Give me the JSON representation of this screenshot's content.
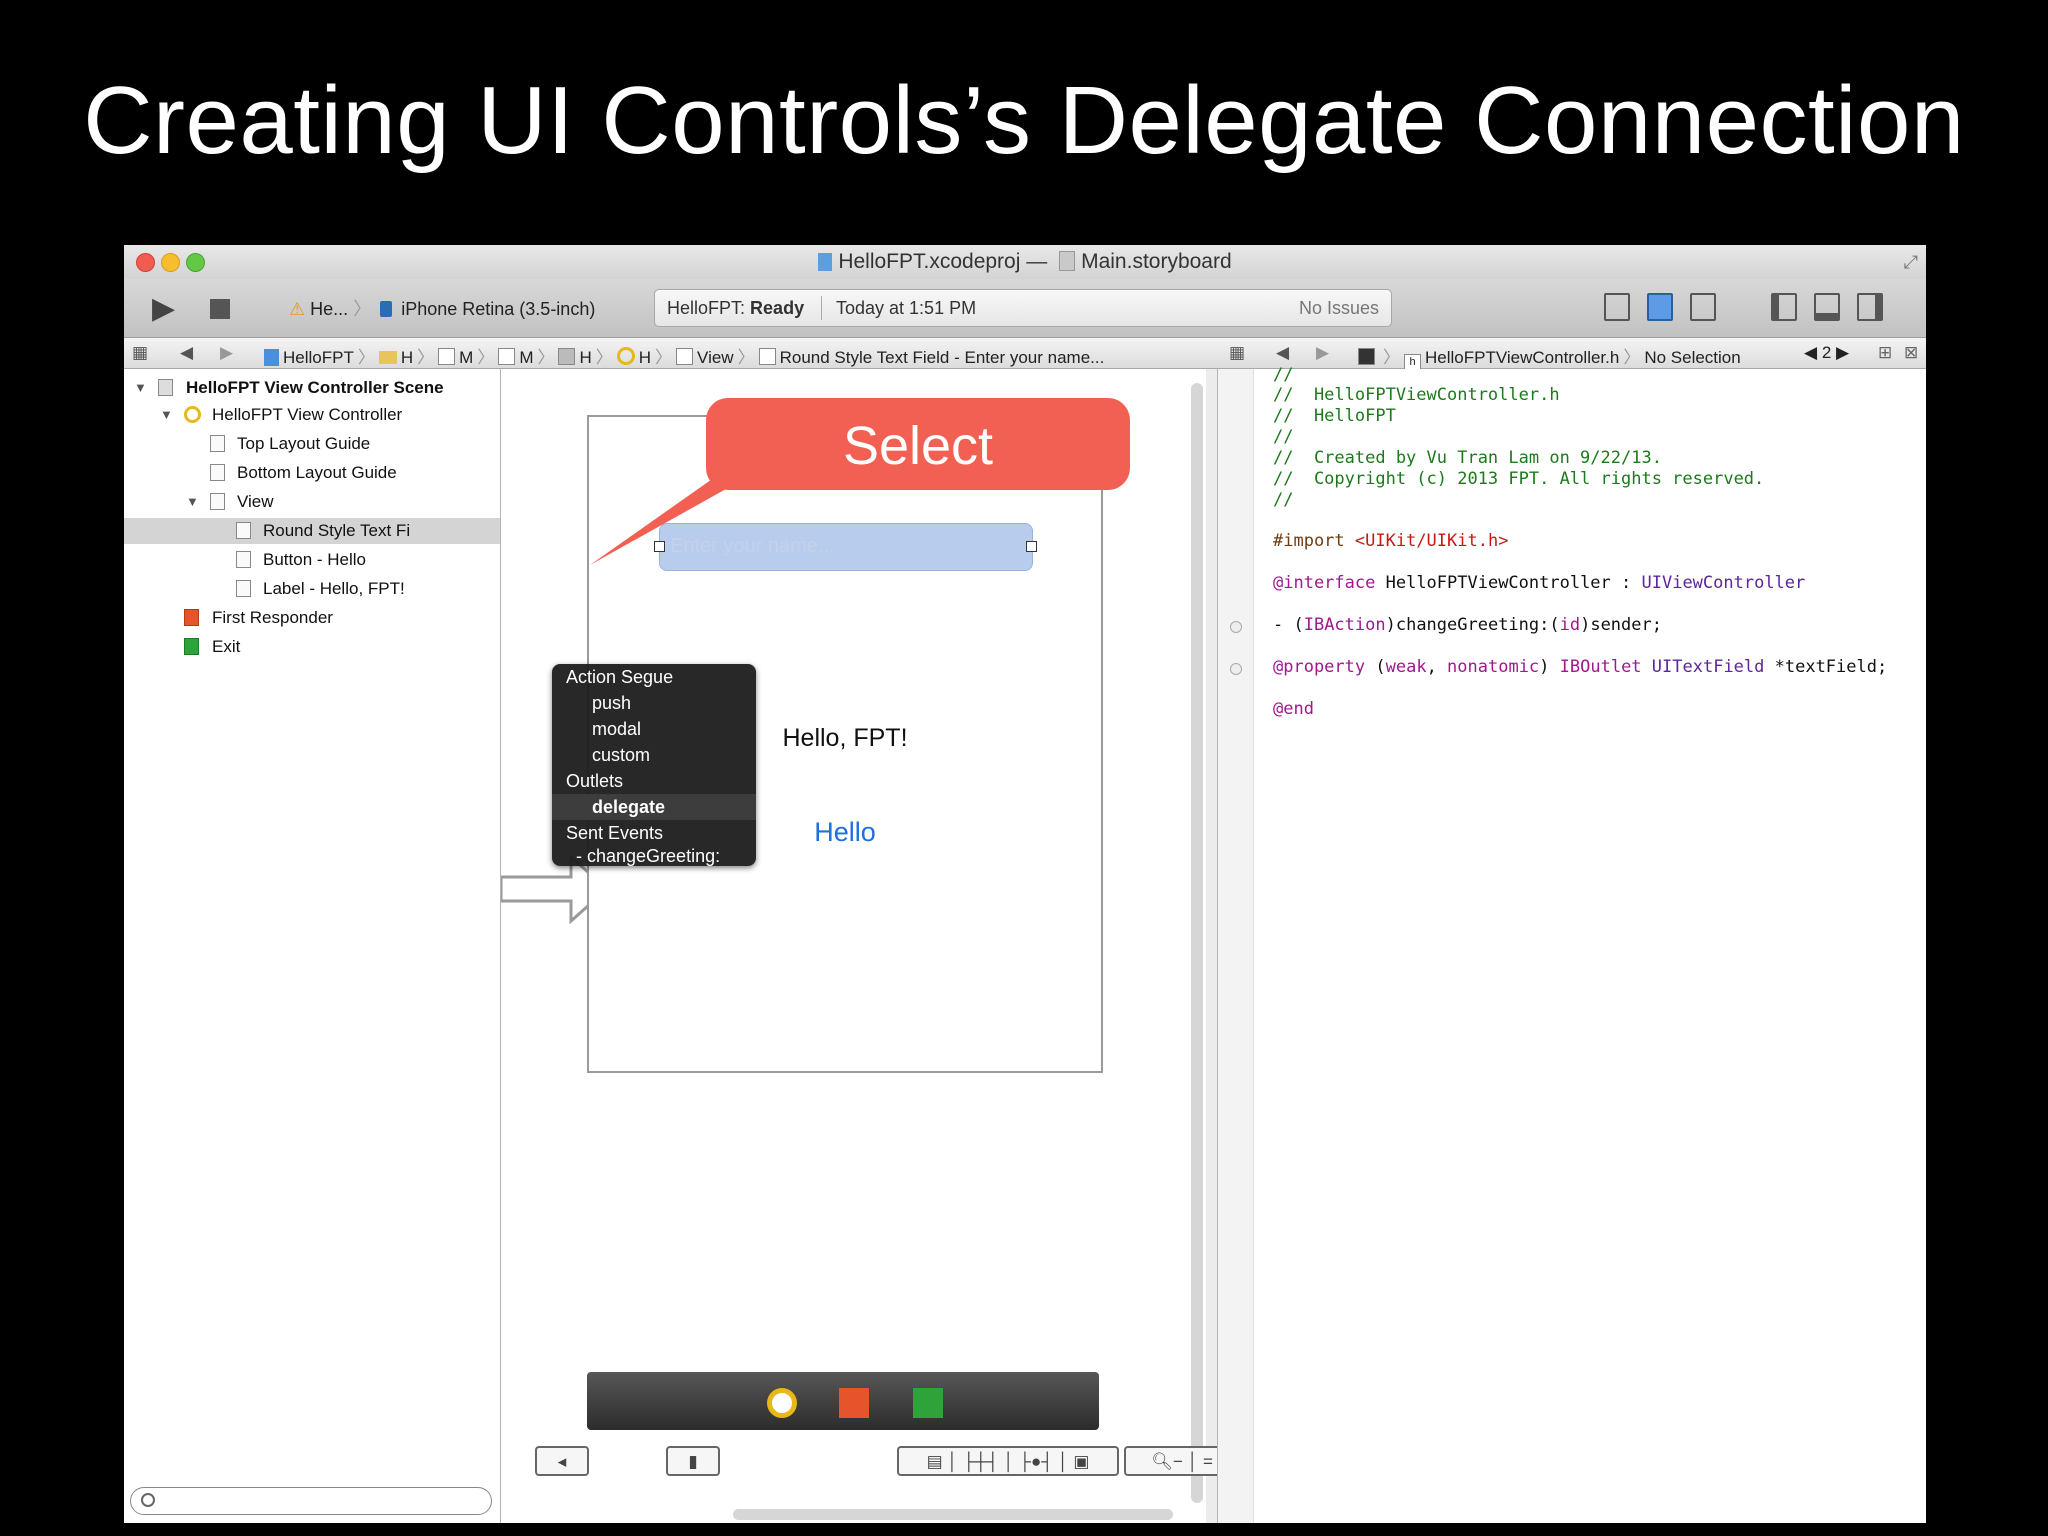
{
  "slide": {
    "title": "Creating UI Controls’s Delegate Connection"
  },
  "window": {
    "project_file": "HelloFPT.xcodeproj",
    "title_separator": "—",
    "storyboard_file": "Main.storyboard"
  },
  "toolbar": {
    "scheme_target": "He...",
    "scheme_device": "iPhone Retina (3.5-inch)",
    "status_project": "HelloFPT:",
    "status_state": "Ready",
    "status_time": "Today at 1:51 PM",
    "status_issues": "No Issues"
  },
  "jumpbar_left": {
    "project": "HelloFPT",
    "h1": "H",
    "m1": "M",
    "m2": "M",
    "h2": "H",
    "h3": "H",
    "view": "View",
    "text_field": "Round Style Text Field - Enter your name..."
  },
  "jumpbar_right": {
    "file": "HelloFPTViewController.h",
    "selection": "No Selection",
    "counter": "2"
  },
  "outline": {
    "scene": "HelloFPT View Controller Scene",
    "controller": "HelloFPT View Controller",
    "top_guide": "Top Layout Guide",
    "bottom_guide": "Bottom Layout Guide",
    "view": "View",
    "text_field": "Round Style Text Fi",
    "button": "Button - Hello",
    "label": "Label - Hello, FPT!",
    "first_responder": "First Responder",
    "exit": "Exit"
  },
  "popup": {
    "action_segue": "Action Segue",
    "push": "push",
    "modal": "modal",
    "custom": "custom",
    "outlets": "Outlets",
    "delegate": "delegate",
    "sent_events": "Sent Events",
    "change_greeting": "- changeGreeting:"
  },
  "callout": {
    "text": "Select"
  },
  "canvas": {
    "placeholder": "Enter your name...",
    "label_text": "Hello, FPT!",
    "button_text": "Hello"
  },
  "code": {
    "l1": "//",
    "l2": "//  HelloFPTViewController.h",
    "l3": "//  HelloFPT",
    "l4": "//",
    "l5": "//  Created by Vu Tran Lam on 9/22/13.",
    "l6": "//  Copyright (c) 2013 FPT. All rights reserved.",
    "l7": "//",
    "import_kw": "#import",
    "import_path": "<UIKit/UIKit.h>",
    "interface_kw": "@interface",
    "class_name": "HelloFPTViewController",
    "colon": " : ",
    "superclass": "UIViewController",
    "action_dash": "- (",
    "ibaction": "IBAction",
    "action_mid": ")changeGreeting:(",
    "id_kw": "id",
    "action_end": ")sender;",
    "property_kw": "@property",
    "prop_open": " (",
    "weak_kw": "weak",
    "prop_comma": ", ",
    "nonatomic_kw": "nonatomic",
    "prop_close": ") ",
    "iboutlet": "IBOutlet",
    "space": " ",
    "uitextfield": "UITextField",
    "prop_name": " *textField;",
    "end_kw": "@end"
  },
  "colors": {
    "callout": "#f25f53",
    "selection_field": "#b8cdee",
    "link_blue": "#1c6fdc",
    "comment_green": "#1c7a1c",
    "keyword_purple": "#a0178f"
  }
}
